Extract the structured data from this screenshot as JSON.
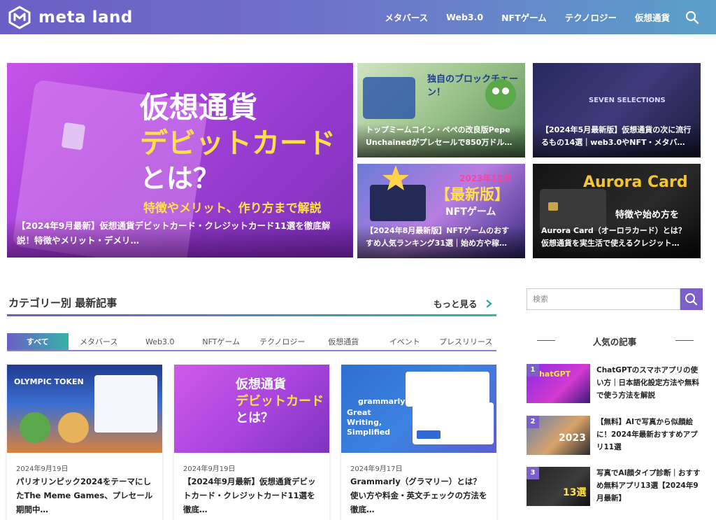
{
  "header": {
    "brand": "meta land",
    "nav": [
      "メタバース",
      "Web3.0",
      "NFTゲーム",
      "テクノロジー",
      "仮想通貨"
    ]
  },
  "hero": {
    "main": {
      "art_title_1": "仮想通貨",
      "art_title_2": "デビットカード",
      "art_title_3": "とは？",
      "art_sub": "特徴やメリット、作り方まで解説",
      "caption": "【2024年9月最新】仮想通貨デビットカード・クレジットカード11選を徹底解説！特徴やメリット・デメリ…"
    },
    "s1": {
      "art": "独自のブロックチェーン！",
      "caption": "トップミームコイン・ペペの改良版Pepe Unchainedがプレセールで850万ドル…"
    },
    "s2": {
      "art": "SEVEN SELECTIONS",
      "caption": "【2024年5月最新版】仮想通貨の次に流行るもの14選｜web3.0やNFT・メタバ…"
    },
    "s3": {
      "art_year": "2023年11月",
      "art": "【最新版】",
      "art_sub": "NFTゲーム",
      "caption": "【2024年8月最新版】NFTゲームのおすすめ人気ランキング31選｜始め方や稼…"
    },
    "s4": {
      "art": "Aurora Card",
      "art_sub": "特徴や始め方を",
      "caption": "Aurora Card（オーロラカード）とは？仮想通貨を実生活で使えるクレジット…"
    }
  },
  "category": {
    "title": "カテゴリー別 最新記事",
    "more": "もっと見る",
    "tabs": [
      "すべて",
      "メタバース",
      "Web3.0",
      "NFTゲーム",
      "テクノロジー",
      "仮想通貨",
      "イベント",
      "プレスリリース"
    ],
    "active_tab": 0,
    "cards": [
      {
        "img_text": "OLYMPIC TOKEN",
        "date": "2024年9月19日",
        "title": "パリオリンピック2024をテーマにしたThe Meme Games、プレセール期間中…"
      },
      {
        "img_text": "仮想通貨",
        "img_text2": "デビットカード",
        "img_text3": "とは？",
        "date": "2024年9月19日",
        "title": "【2024年9月最新】仮想通貨デビットカード・クレジットカード11選を徹底…"
      },
      {
        "img_text": "grammarly",
        "img_text2": "Great Writing, Simplified",
        "date": "2024年9月17日",
        "title": "Grammarly（グラマリー）とは？使い方や料金・英文チェックの方法を徹底…"
      }
    ]
  },
  "sidebar": {
    "search_placeholder": "検索",
    "popular_title": "人気の記事",
    "popular": [
      {
        "rank": "1",
        "thumb": "ChatGPT",
        "title": "ChatGPTのスマホアプリの使い方｜日本語化設定方法や無料で使う方法を解説"
      },
      {
        "rank": "2",
        "thumb": "2023",
        "title": "【無料】AIで写真から似顔絵に！2024年最新おすすめアプリ11選"
      },
      {
        "rank": "3",
        "thumb": "13選",
        "title": "写真でAI顔タイプ診断｜おすすめ無料アプリ13選【2024年9月最新】"
      }
    ]
  }
}
